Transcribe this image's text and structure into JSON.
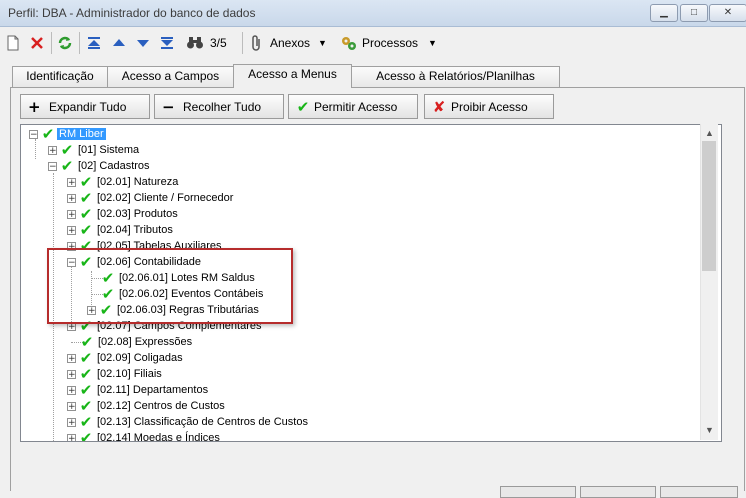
{
  "window": {
    "title": "Perfil: DBA - Administrador do banco de dados"
  },
  "toolbar": {
    "page_indicator": "3/5",
    "anexos_label": "Anexos",
    "processos_label": "Processos"
  },
  "tabs": [
    {
      "label": "Identificação"
    },
    {
      "label": "Acesso a Campos"
    },
    {
      "label": "Acesso a Menus"
    },
    {
      "label": "Acesso à Relatórios/Planilhas"
    }
  ],
  "actions": {
    "expand": "Expandir Tudo",
    "collapse": "Recolher Tudo",
    "permit": "Permitir Acesso",
    "deny": "Proibir Acesso"
  },
  "tree": {
    "root": "RM Liber",
    "nodes": [
      {
        "label": "[01] Sistema",
        "expander": "+"
      },
      {
        "label": "[02] Cadastros",
        "expander": "−"
      },
      {
        "label": "[02.01] Natureza",
        "expander": "+"
      },
      {
        "label": "[02.02] Cliente / Fornecedor",
        "expander": "+"
      },
      {
        "label": "[02.03] Produtos",
        "expander": "+"
      },
      {
        "label": "[02.04] Tributos",
        "expander": "+"
      },
      {
        "label": "[02.05] Tabelas Auxiliares",
        "expander": "+"
      },
      {
        "label": "[02.06] Contabilidade",
        "expander": "−"
      },
      {
        "label": "[02.06.01] Lotes RM Saldus",
        "expander": ""
      },
      {
        "label": "[02.06.02] Eventos Contábeis",
        "expander": ""
      },
      {
        "label": "[02.06.03] Regras Tributárias",
        "expander": "+"
      },
      {
        "label": "[02.07] Campos Complementares",
        "expander": "+"
      },
      {
        "label": "[02.08] Expressões",
        "expander": ""
      },
      {
        "label": "[02.09] Coligadas",
        "expander": "+"
      },
      {
        "label": "[02.10] Filiais",
        "expander": "+"
      },
      {
        "label": "[02.11] Departamentos",
        "expander": "+"
      },
      {
        "label": "[02.12] Centros de Custos",
        "expander": "+"
      },
      {
        "label": "[02.13] Classificação de Centros de Custos",
        "expander": "+"
      },
      {
        "label": "[02.14] Moedas e Índices",
        "expander": "+"
      }
    ]
  },
  "colors": {
    "check": "#18b518",
    "selection": "#3399ff",
    "highlight": "#b62c2c"
  },
  "icons": [
    "new-icon",
    "delete-icon",
    "refresh-icon",
    "first-icon",
    "prev-icon",
    "next-icon",
    "last-icon",
    "binoculars-icon",
    "paperclip-icon",
    "gears-icon",
    "check-icon",
    "expand-icon",
    "collapse-icon"
  ]
}
